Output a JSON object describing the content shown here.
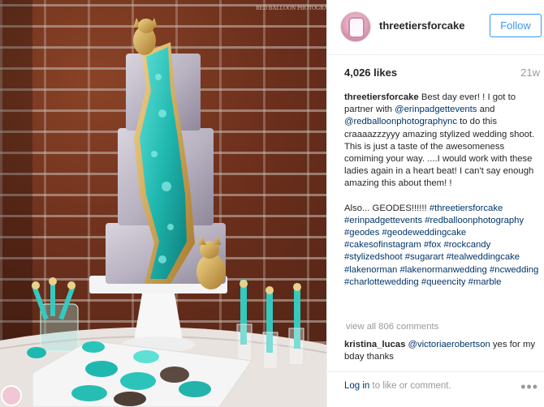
{
  "post": {
    "username": "threetiersforcake",
    "follow_label": "Follow",
    "likes": "4,026 likes",
    "age": "21w",
    "caption": {
      "username": "threetiersforcake",
      "p1": [
        {
          "text": "Best day ever! ! I got to partner with ",
          "tag": false
        },
        {
          "text": "@erinpadgettevents",
          "tag": true
        },
        {
          "text": " and ",
          "tag": false
        },
        {
          "text": "@redballoonphotographync",
          "tag": true
        },
        {
          "text": " to do this craaaazzzyyy amazing stylized wedding shoot. This is just a taste of the awesomeness comiming your way. ....I would work with these ladies again in a heart beat! I can't say enough amazing this about them! !",
          "tag": false
        }
      ],
      "p2_lead": "Also... GEODES!!!!!! ",
      "hashtags": [
        "#threetiersforcake",
        "#erinpadgettevents",
        "#redballoonphotography",
        "#geodes",
        "#geodeweddingcake",
        "#cakesofinstagram",
        "#fox",
        "#rockcandy",
        "#stylizedshoot",
        "#sugarart",
        "#tealweddingcake",
        "#lakenorman",
        "#lakenormanwedding",
        "#ncwedding",
        "#charlottewedding",
        "#queencity",
        "#marble"
      ]
    },
    "view_all": "view all 806 comments",
    "comment": {
      "username": "kristina_lucas",
      "mention": "@victoriaerobertson",
      "text": " yes for my bday thanks"
    },
    "footer": {
      "login_link": "Log in",
      "login_rest": " to like or comment.",
      "more_icon": "ellipsis-icon"
    }
  },
  "colors": {
    "link": "#003569",
    "follow": "#3897f0",
    "muted": "#999999",
    "teal": "#1fb8b0",
    "gold": "#c9a24a"
  }
}
